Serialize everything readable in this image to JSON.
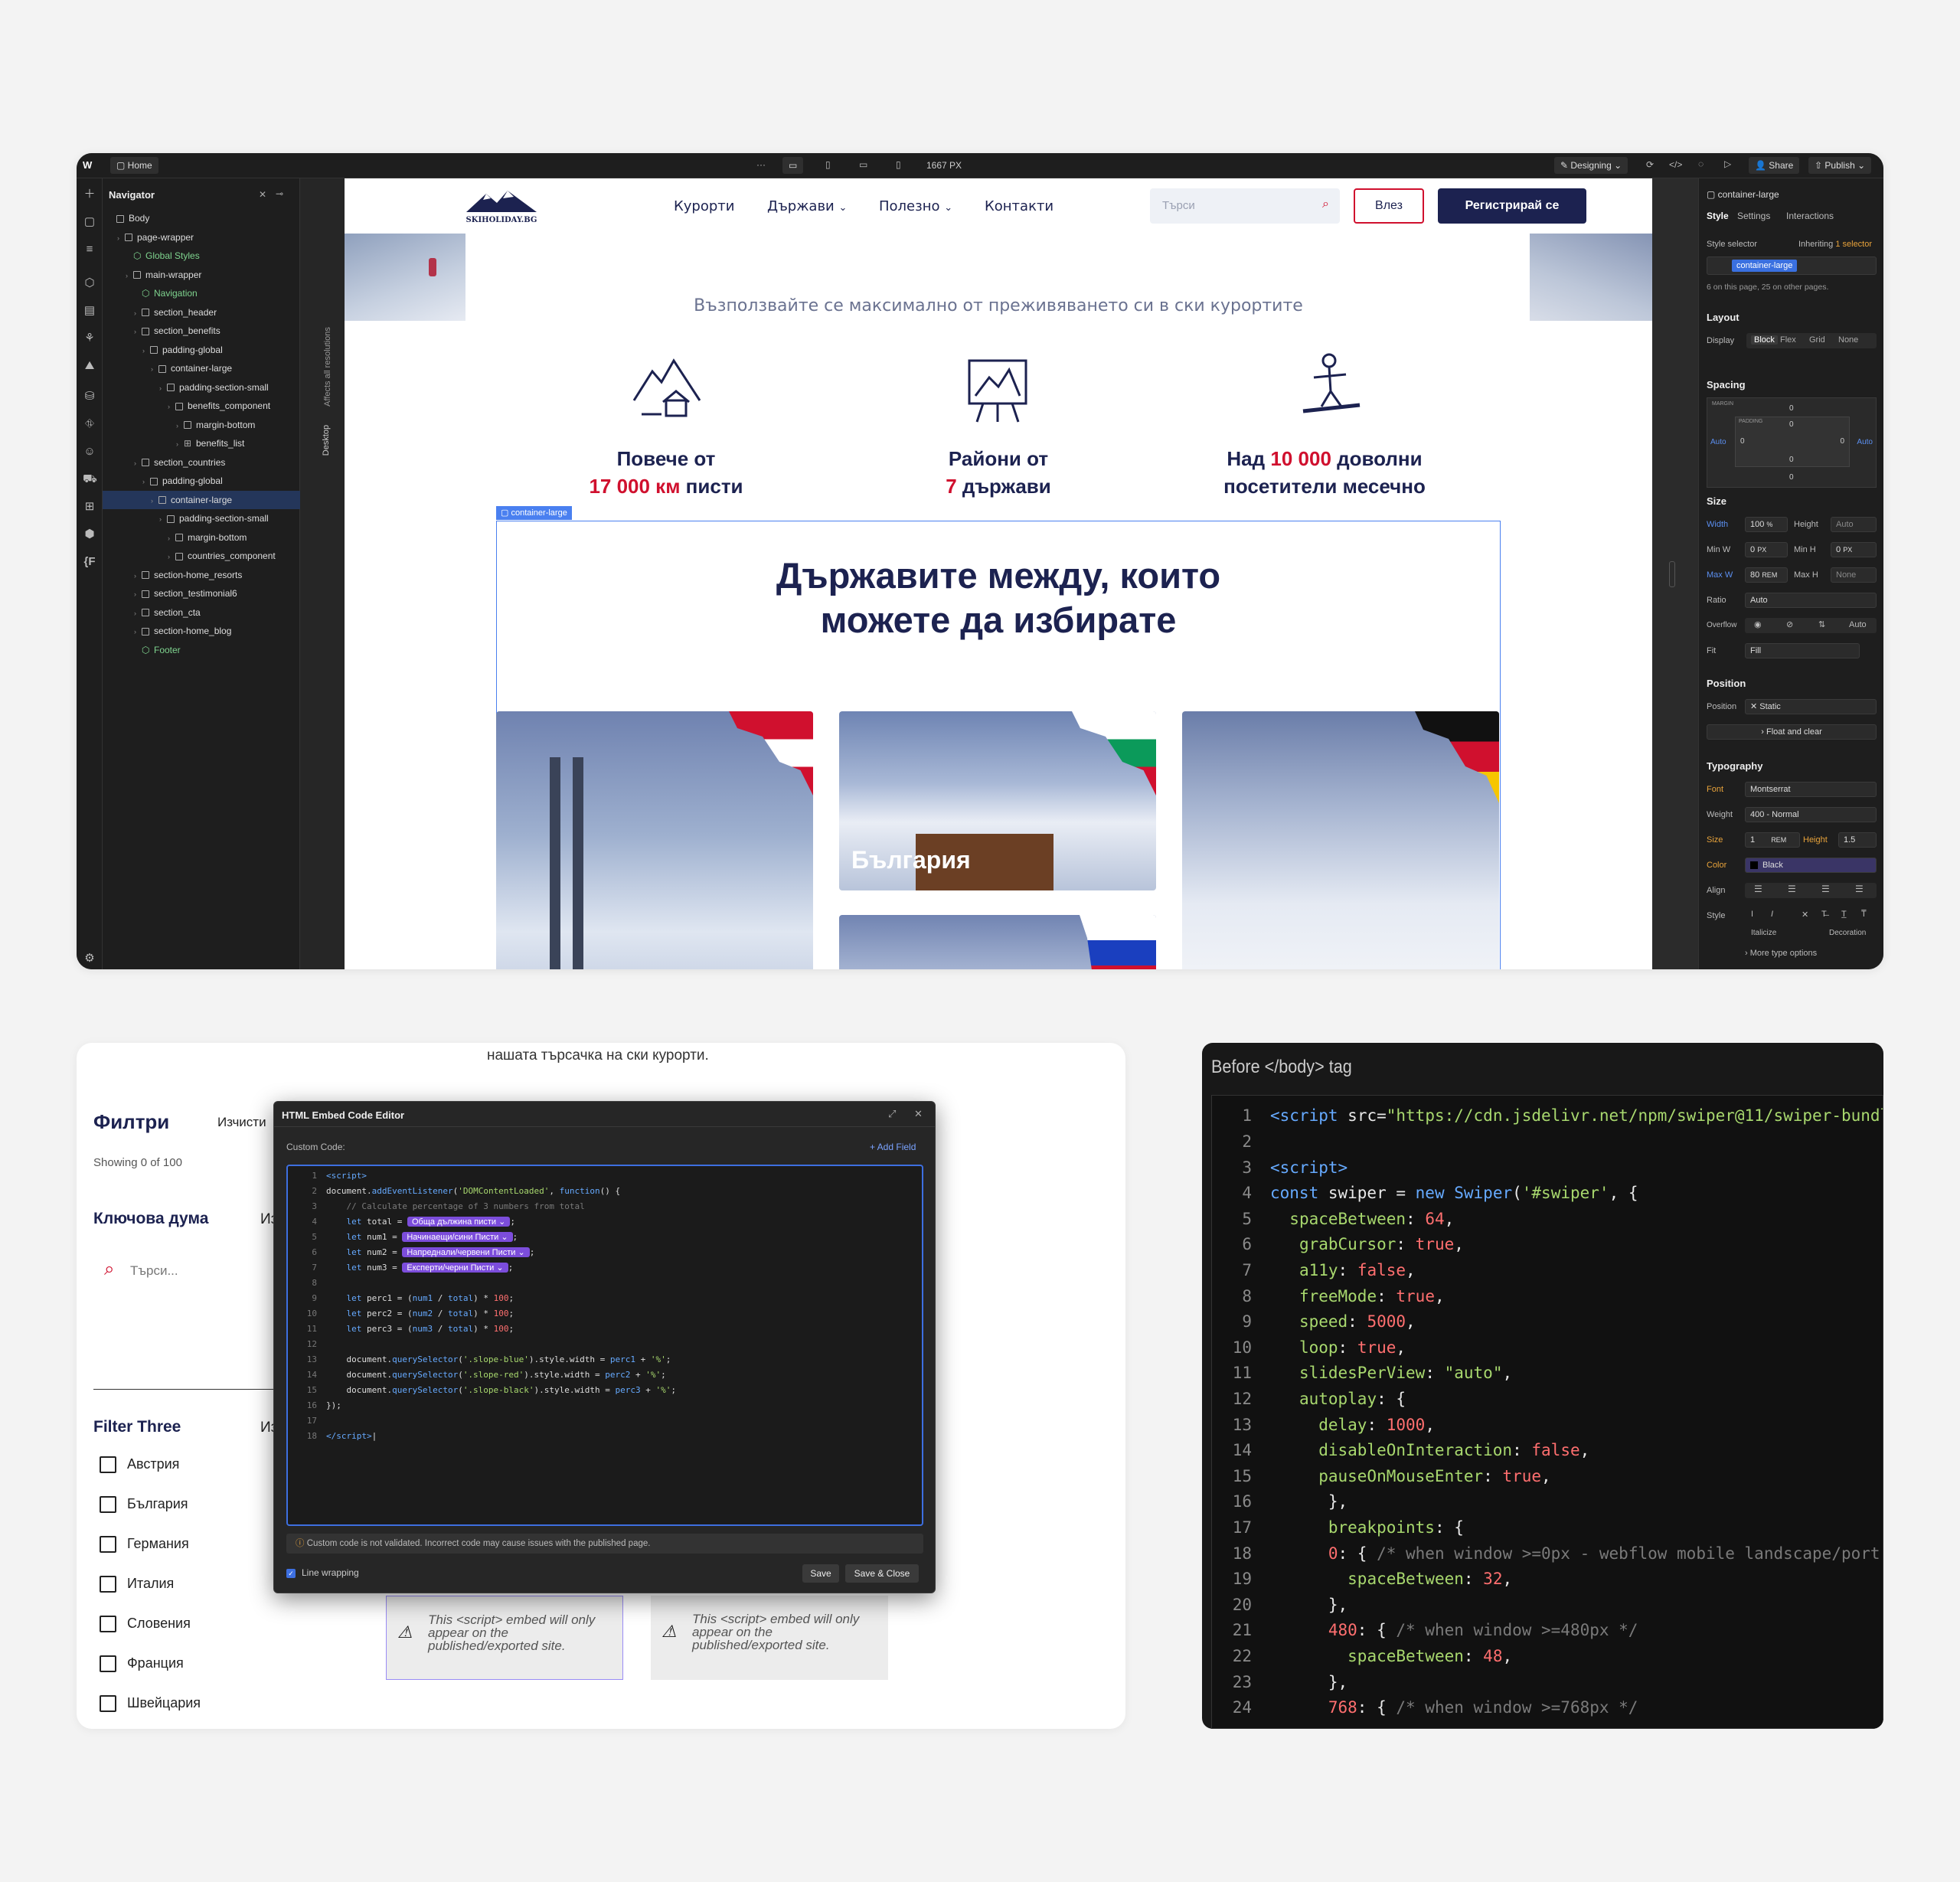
{
  "editor": {
    "topbar": {
      "page": "Home",
      "width_px": "1667 PX",
      "mode": "Designing",
      "share": "Share",
      "publish": "Publish"
    },
    "navigator": {
      "title": "Navigator",
      "items": [
        {
          "label": "Body",
          "indent": 0,
          "kind": "box"
        },
        {
          "label": "page-wrapper",
          "indent": 1,
          "kind": "box"
        },
        {
          "label": "Global Styles",
          "indent": 2,
          "kind": "comp"
        },
        {
          "label": "main-wrapper",
          "indent": 2,
          "kind": "box"
        },
        {
          "label": "Navigation",
          "indent": 3,
          "kind": "comp"
        },
        {
          "label": "section_header",
          "indent": 3,
          "kind": "box"
        },
        {
          "label": "section_benefits",
          "indent": 3,
          "kind": "box"
        },
        {
          "label": "padding-global",
          "indent": 4,
          "kind": "box"
        },
        {
          "label": "container-large",
          "indent": 5,
          "kind": "box"
        },
        {
          "label": "padding-section-small",
          "indent": 6,
          "kind": "box"
        },
        {
          "label": "benefits_component",
          "indent": 7,
          "kind": "box"
        },
        {
          "label": "margin-bottom",
          "indent": 8,
          "kind": "box"
        },
        {
          "label": "benefits_list",
          "indent": 8,
          "kind": "grid"
        },
        {
          "label": "section_countries",
          "indent": 3,
          "kind": "box"
        },
        {
          "label": "padding-global",
          "indent": 4,
          "kind": "box"
        },
        {
          "label": "container-large",
          "indent": 5,
          "kind": "box",
          "selected": true
        },
        {
          "label": "padding-section-small",
          "indent": 6,
          "kind": "box"
        },
        {
          "label": "margin-bottom",
          "indent": 7,
          "kind": "box"
        },
        {
          "label": "countries_component",
          "indent": 7,
          "kind": "box"
        },
        {
          "label": "section-home_resorts",
          "indent": 3,
          "kind": "box"
        },
        {
          "label": "section_testimonial6",
          "indent": 3,
          "kind": "box"
        },
        {
          "label": "section_cta",
          "indent": 3,
          "kind": "box"
        },
        {
          "label": "section-home_blog",
          "indent": 3,
          "kind": "box"
        },
        {
          "label": "Footer",
          "indent": 3,
          "kind": "comp"
        }
      ]
    },
    "vstrip": {
      "affects": "Affects all resolutions",
      "desktop": "Desktop"
    },
    "site": {
      "logo": "SKIHOLIDAY.BG",
      "nav": [
        "Курорти",
        "Държави",
        "Полезно",
        "Контакти"
      ],
      "search_placeholder": "Търси",
      "login": "Влез",
      "register": "Регистрирай се",
      "tagline": "Възползвайте се максимално от преживяването си в ски курортите",
      "stats": [
        {
          "line1": "Повече от",
          "hl": "17 000 км",
          "line2": "писти"
        },
        {
          "line1": "Райони от",
          "hl": "7",
          "line2": "държави"
        },
        {
          "line1": "Над",
          "hl": "10 000",
          "line1b": "доволни",
          "line2": "посетители месечно"
        }
      ],
      "selection_label": "container-large",
      "heading": "Държавите между, които можете да избирате",
      "country_card": "България"
    },
    "style_panel": {
      "selector": "container-large",
      "tabs": [
        "Style",
        "Settings",
        "Interactions"
      ],
      "style_selector": "Style selector",
      "inheriting": "Inheriting",
      "inheriting_count": "1 selector",
      "usage": "6 on this page, 25 on other pages.",
      "layout": "Layout",
      "display": "Display",
      "display_opts": [
        "Block",
        "Flex",
        "Grid",
        "None"
      ],
      "spacing": "Spacing",
      "margin": "MARGIN",
      "padding": "PADDING",
      "auto": "Auto",
      "zero": "0",
      "size": "Size",
      "width_label": "Width",
      "width": "100",
      "width_unit": "%",
      "height_label": "Height",
      "height": "Auto",
      "minw_label": "Min W",
      "minw": "0",
      "minh_label": "Min H",
      "minh": "0",
      "px": "PX",
      "maxw_label": "Max W",
      "maxw": "80",
      "maxw_unit": "REM",
      "maxh_label": "Max H",
      "maxh": "None",
      "ratio_label": "Ratio",
      "ratio": "Auto",
      "overflow_label": "Overflow",
      "overflow_auto": "Auto",
      "fit_label": "Fit",
      "fit": "Fill",
      "position": "Position",
      "position_label": "Position",
      "position_val": "Static",
      "float": "Float and clear",
      "typography": "Typography",
      "font_label": "Font",
      "font": "Montserrat",
      "weight_label": "Weight",
      "weight": "400 - Normal",
      "size_label": "Size",
      "size_val": "1",
      "size_unit": "REM",
      "height2_label": "Height",
      "height2": "1.5",
      "color_label": "Color",
      "color": "Black",
      "align_label": "Align",
      "style_label": "Style",
      "italicize": "Italicize",
      "decoration": "Decoration",
      "more": "More type options"
    }
  },
  "filters": {
    "top_text": "нашата търсачка на ски курорти.",
    "title": "Филтри",
    "clear": "Изчисти",
    "showing": "Showing 0 of 100",
    "keyword": "Ключова дума",
    "keyword_clear": "Из",
    "search": "Търси...",
    "filter_three": "Filter Three",
    "ft_clear": "Из",
    "countries": [
      "Австрия",
      "България",
      "Германия",
      "Италия",
      "Словения",
      "Франция",
      "Швейцария"
    ],
    "embed_warning": "This <script> embed will only appear on the published/exported site."
  },
  "modal": {
    "title": "HTML Embed Code Editor",
    "custom_code": "Custom Code:",
    "add_field": "+ Add Field",
    "tags": [
      "Обща дължина писти",
      "Начинаещи/сини Писти",
      "Напреднали/червени Писти",
      "Експерти/черни Писти"
    ],
    "warning": "Custom code is not validated. Incorrect code may cause issues with the published page.",
    "line_wrapping": "Line wrapping",
    "save": "Save",
    "save_close": "Save & Close"
  },
  "code_panel": {
    "title": "Before </body> tag"
  },
  "colors": {
    "accent": "#d0102e",
    "navy": "#1c2250",
    "selection": "#4a80f0",
    "tag": "#7c4ddb"
  }
}
